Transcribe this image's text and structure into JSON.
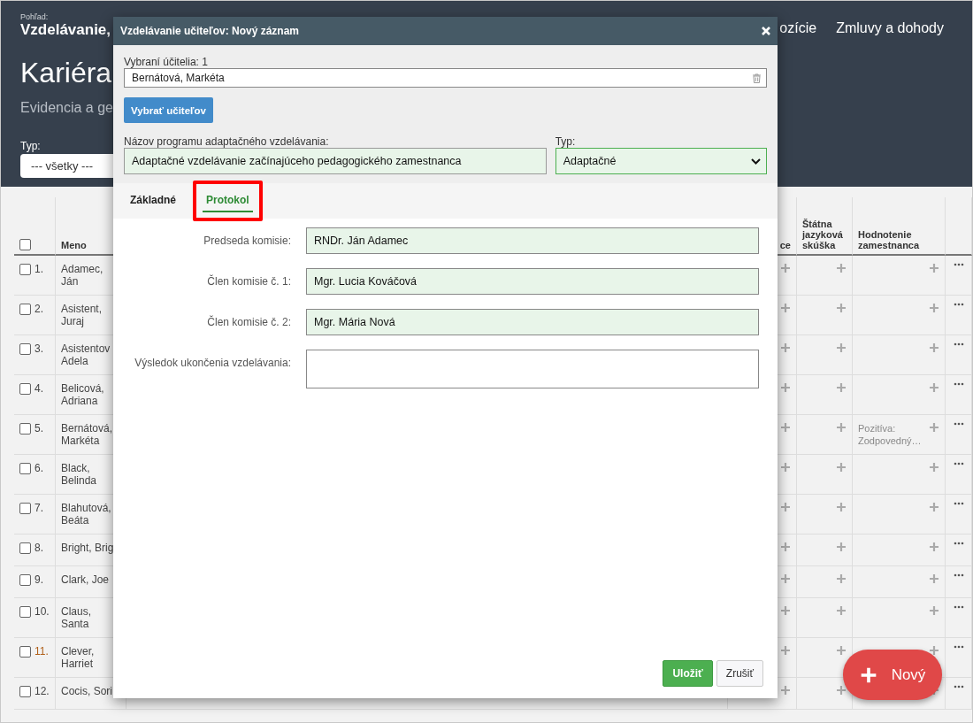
{
  "header": {
    "view_label": "Pohľad:",
    "view_title": "Vzdelávanie,",
    "nav": [
      "ozície",
      "Zmluvy a dohody"
    ],
    "title": "Kariéra",
    "subtitle": "Evidencia a ge",
    "filter": {
      "label": "Typ:",
      "value": "--- všetky ---"
    }
  },
  "table": {
    "select_all_checked": false,
    "columns": {
      "name": "Meno",
      "column_4": "ce",
      "language_exam": "Štátna jazyková skúška",
      "evaluation": "Hodnotenie zamestnanca"
    },
    "rows": [
      {
        "number": "1.",
        "name_lines": [
          "Adamec,",
          "Ján"
        ],
        "checked": false,
        "flagged": false
      },
      {
        "number": "2.",
        "name_lines": [
          "Asistent,",
          "Juraj"
        ],
        "checked": false,
        "flagged": false
      },
      {
        "number": "3.",
        "name_lines": [
          "Asistentov",
          "Adela"
        ],
        "checked": false,
        "flagged": false
      },
      {
        "number": "4.",
        "name_lines": [
          "Belicová,",
          "Adriana"
        ],
        "checked": false,
        "flagged": false
      },
      {
        "number": "5.",
        "name_lines": [
          "Bernátová,",
          "Markéta"
        ],
        "checked": false,
        "flagged": false,
        "evaluation": "Pozitíva: Zodpovedný…"
      },
      {
        "number": "6.",
        "name_lines": [
          "Black,",
          "Belinda"
        ],
        "checked": false,
        "flagged": false
      },
      {
        "number": "7.",
        "name_lines": [
          "Blahutová,",
          "Beáta"
        ],
        "checked": false,
        "flagged": false
      },
      {
        "number": "8.",
        "name_lines": [
          "Bright, Brig"
        ],
        "checked": false,
        "flagged": false
      },
      {
        "number": "9.",
        "name_lines": [
          "Clark, Joe"
        ],
        "checked": false,
        "flagged": false
      },
      {
        "number": "10.",
        "name_lines": [
          "Claus,",
          "Santa"
        ],
        "checked": false,
        "flagged": false
      },
      {
        "number": "11.",
        "name_lines": [
          "Clever,",
          "Harriet"
        ],
        "checked": false,
        "flagged": true
      },
      {
        "number": "12.",
        "name_lines": [
          "Cocis, Sori"
        ],
        "checked": false,
        "flagged": false
      }
    ]
  },
  "dialog": {
    "title": "Vzdelávanie učiteľov: Nový záznam",
    "selected_label": "Vybraní účitelia: 1",
    "selected_value": "Bernátová, Markéta",
    "select_button": "Vybrať učiteľov",
    "program_label": "Názov programu adaptačného vzdelávania:",
    "program_value": "Adaptačné vzdelávanie začínajúceho pedagogického zamestnanca",
    "type_label": "Typ:",
    "type_value": "Adaptačné",
    "tabs": [
      {
        "label": "Základné",
        "selected": false,
        "highlighted": false
      },
      {
        "label": "Protokol",
        "selected": true,
        "highlighted": true
      }
    ],
    "fields": [
      {
        "kind": "input",
        "label": "Predseda komisie:",
        "value": "RNDr. Ján Adamec"
      },
      {
        "kind": "input",
        "label": "Člen komisie č. 1:",
        "value": "Mgr. Lucia Kováčová"
      },
      {
        "kind": "input",
        "label": "Člen komisie č. 2:",
        "value": "Mgr. Mária Nová"
      },
      {
        "kind": "textarea",
        "label": "Výsledok ukončenia vzdelávania:"
      }
    ],
    "buttons": [
      {
        "kind": "primary",
        "label": "Uložiť"
      },
      {
        "kind": "secondary",
        "label": "Zrušiť"
      }
    ]
  },
  "fab": {
    "label": "Nový"
  }
}
